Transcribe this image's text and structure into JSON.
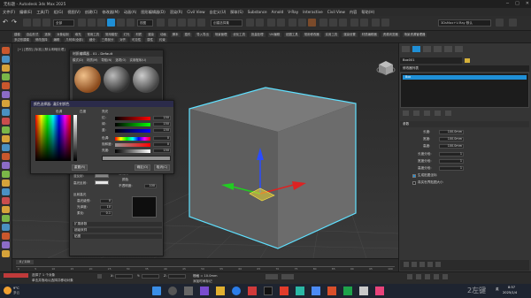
{
  "window": {
    "title": "无标题 - Autodesk 3ds Max 2025"
  },
  "menubar": {
    "items": [
      "文件(F)",
      "编辑(E)",
      "工具(T)",
      "组(G)",
      "视图(V)",
      "创建(C)",
      "修改器(M)",
      "动画(A)",
      "图形编辑器(D)",
      "渲染(R)",
      "Civil View",
      "自定义(U)",
      "脚本(S)",
      "Substance",
      "Arnold",
      "V-Ray",
      "Interactive",
      "Civil View",
      "内容",
      "帮助(H)"
    ]
  },
  "toolbar": {
    "selection_filter": "全部",
    "view_label": "视图",
    "selection_set": "创建选择集",
    "workspace": "3DsMax+V-Ray 默认"
  },
  "ribbon": {
    "row1": [
      "建模",
      "自由形式",
      "选择",
      "对象绘制",
      "填充",
      "常用工具",
      "常用模型",
      "灯光",
      "材质",
      "渲染",
      "动画",
      "脚本",
      "插件",
      "导入导出",
      "场景管理",
      "优化工具",
      "批量处理",
      "UV编辑",
      "贴图工具",
      "常用修改器",
      "实用工具",
      "渲染设置",
      "材质编辑器",
      "资源浏览器",
      "场景资源管理器"
    ],
    "row2": [
      "多边形建模",
      "修改选择",
      "编辑",
      "几何体(全部)",
      "细分",
      "三角剖分",
      "对齐",
      "可见性",
      "属性",
      "约束"
    ]
  },
  "viewport": {
    "label": "[+] [透视] [标准] [默认明暗处理]"
  },
  "material_editor": {
    "title": "材质编辑器 - 01 - Default",
    "menu": [
      "模式(D)",
      "材质(M)",
      "导航(N)",
      "选项(O)",
      "实用程序(U)"
    ],
    "rollouts": [
      "扩展参数",
      "超级采样",
      "贴图"
    ],
    "labels": [
      "环境光:",
      "漫反射:",
      "高光反射:",
      "自发光",
      "颜色",
      "不透明度:",
      "反射高光",
      "高光级别:",
      "光泽度:",
      "柔化:"
    ],
    "values": {
      "opacity": "100",
      "spec_level": "0",
      "gloss": "10",
      "soften": "0.1"
    }
  },
  "color_dialog": {
    "title": "颜色选择器: 漫反射颜色",
    "left_header": "色调",
    "right_header": "白度",
    "subhead": "亮光",
    "channels": [
      "红:",
      "绿:",
      "蓝:",
      "色调:",
      "饱和度:",
      "亮度:"
    ],
    "values": [
      "150",
      "150",
      "150",
      "0",
      "0",
      "150"
    ],
    "buttons": [
      "重置(R)",
      "确定(O)",
      "取消(C)"
    ]
  },
  "cmdpanel": {
    "object_name": "Box001",
    "modifier_list": "修改器列表",
    "stack_item": "Box",
    "rollout": "参数",
    "params": [
      {
        "label": "长度:",
        "value": "100.0mm"
      },
      {
        "label": "宽度:",
        "value": "100.0mm"
      },
      {
        "label": "高度:",
        "value": "100.0mm"
      },
      {
        "label": "长度分段:",
        "value": "1"
      },
      {
        "label": "宽度分段:",
        "value": "1"
      },
      {
        "label": "高度分段:",
        "value": "1"
      }
    ],
    "checks": [
      "生成贴图坐标",
      "真实世界贴图大小"
    ]
  },
  "timebar": {
    "frame": "0 / 100",
    "ticks": [
      "0",
      "5",
      "10",
      "15",
      "20",
      "25",
      "30",
      "35",
      "40",
      "45",
      "50",
      "55",
      "60",
      "65",
      "70",
      "75",
      "80",
      "85",
      "90",
      "95",
      "100"
    ]
  },
  "statusbar": {
    "selection": "选择了 1 个对象",
    "prompt": "单击并拖动以选择并移动对象",
    "grid": "栅格 = 10.0mm",
    "add_tag": "添加时间标记",
    "x": "X:",
    "y": "Y:",
    "z": "Z:"
  },
  "taskbar": {
    "weather_temp": "9°C",
    "weather_desc": "多云",
    "time": "8:57",
    "date": "2025/1/4",
    "lang": "英",
    "watermark": "2左键"
  },
  "colors": {
    "accent": "#1f8fd6",
    "selection": "#5fe0ff",
    "box": "#6b6b6b"
  }
}
